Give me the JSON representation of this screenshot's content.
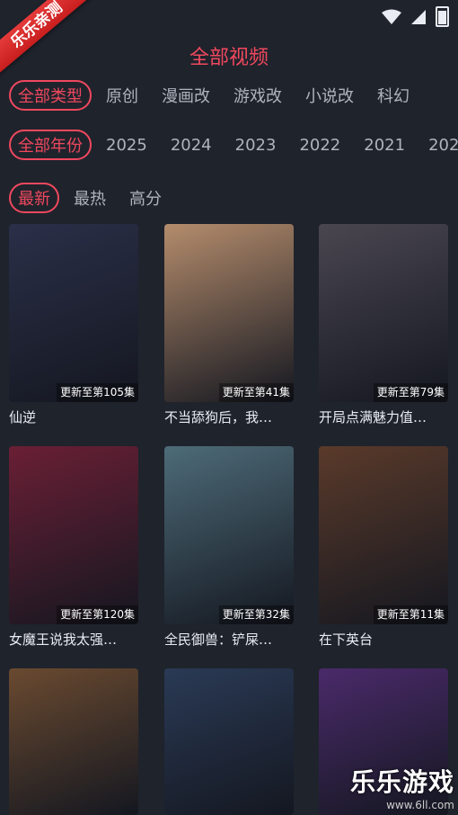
{
  "status": {
    "time": ""
  },
  "ribbon": "乐乐亲测",
  "header": {
    "title": "全部视频"
  },
  "type_filters": [
    "全部类型",
    "原创",
    "漫画改",
    "游戏改",
    "小说改",
    "科幻"
  ],
  "year_filters": [
    "全部年份",
    "2025",
    "2024",
    "2023",
    "2022",
    "2021",
    "202"
  ],
  "sort_filters": [
    "最新",
    "最热",
    "高分"
  ],
  "items": [
    {
      "title": "仙逆",
      "badge": "更新至第105集",
      "color": "#2b2f48"
    },
    {
      "title": "不当舔狗后，我…",
      "badge": "更新至第41集",
      "color": "#b48c6c"
    },
    {
      "title": "开局点满魅力值…",
      "badge": "更新至第79集",
      "color": "#4a4650"
    },
    {
      "title": "女魔王说我太强…",
      "badge": "更新至第120集",
      "color": "#6a1f35"
    },
    {
      "title": "全民御兽：铲屎…",
      "badge": "更新至第32集",
      "color": "#4d6b78"
    },
    {
      "title": "在下英台",
      "badge": "更新至第11集",
      "color": "#5a3a2a"
    },
    {
      "title": "",
      "badge": "",
      "color": "#6a4a30"
    },
    {
      "title": "",
      "badge": "",
      "color": "#2a3a55"
    },
    {
      "title": "",
      "badge": "",
      "color": "#4a2a6a"
    }
  ],
  "watermark": {
    "name": "乐乐游戏",
    "url": "www.6ll.com"
  }
}
